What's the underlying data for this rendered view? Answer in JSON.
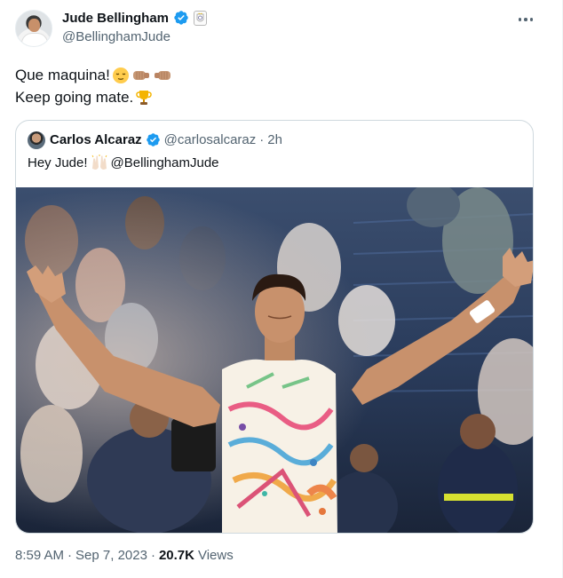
{
  "author": {
    "display_name": "Jude Bellingham",
    "handle": "@BellinghamJude"
  },
  "tweet": {
    "line1": "Que maquina!",
    "line2": "Keep going mate."
  },
  "quoted": {
    "display_name": "Carlos Alcaraz",
    "handle": "@carlosalcaraz",
    "separator": "·",
    "time": "2h",
    "text_before": "Hey Jude!",
    "text_after": "@BellinghamJude"
  },
  "meta": {
    "time": "8:59 AM",
    "sep1": "·",
    "date": "Sep 7, 2023",
    "sep2": "·",
    "views_count": "20.7K",
    "views_label": "Views"
  },
  "colors": {
    "verified": "#1d9bf0",
    "secondary_text": "#536471",
    "border": "#cfd9de",
    "stadium_blue": "#1b3a6b",
    "skin": "#c8906a"
  },
  "icons": [
    "verified-badge-icon",
    "real-madrid-badge-icon",
    "more-options-icon",
    "relieved-face-emoji",
    "fist-left-emoji",
    "fist-right-emoji",
    "trophy-emoji",
    "raising-hands-emoji"
  ]
}
